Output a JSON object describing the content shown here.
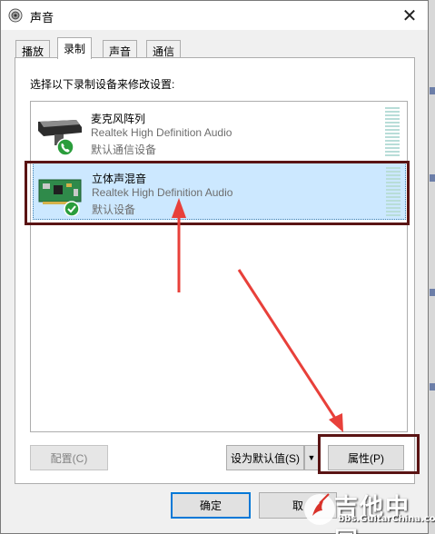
{
  "window": {
    "title": "声音",
    "close_glyph": "✕"
  },
  "tabs": [
    {
      "label": "播放",
      "active": false
    },
    {
      "label": "录制",
      "active": true
    },
    {
      "label": "声音",
      "active": false
    },
    {
      "label": "通信",
      "active": false
    }
  ],
  "panel": {
    "instruction": "选择以下录制设备来修改设置:"
  },
  "devices": [
    {
      "name": "麦克风阵列",
      "driver": "Realtek High Definition Audio",
      "status": "默认通信设备",
      "icon": "microphone-array-icon",
      "badge": "phone-badge-icon",
      "selected": false
    },
    {
      "name": "立体声混音",
      "driver": "Realtek High Definition Audio",
      "status": "默认设备",
      "icon": "sound-card-icon",
      "badge": "checkmark-badge-icon",
      "selected": true
    }
  ],
  "buttons": {
    "configure": "配置(C)",
    "set_default": "设为默认值(S)",
    "properties": "属性(P)",
    "ok": "确定",
    "cancel": "取"
  },
  "colors": {
    "selection": "#cce8ff",
    "highlight_box": "#5a1414",
    "annotation_arrow": "#e8403a",
    "badge_green": "#2a9d3c"
  },
  "watermark": {
    "text": "吉他中国",
    "url": "bbs.GuitarChina.com"
  }
}
